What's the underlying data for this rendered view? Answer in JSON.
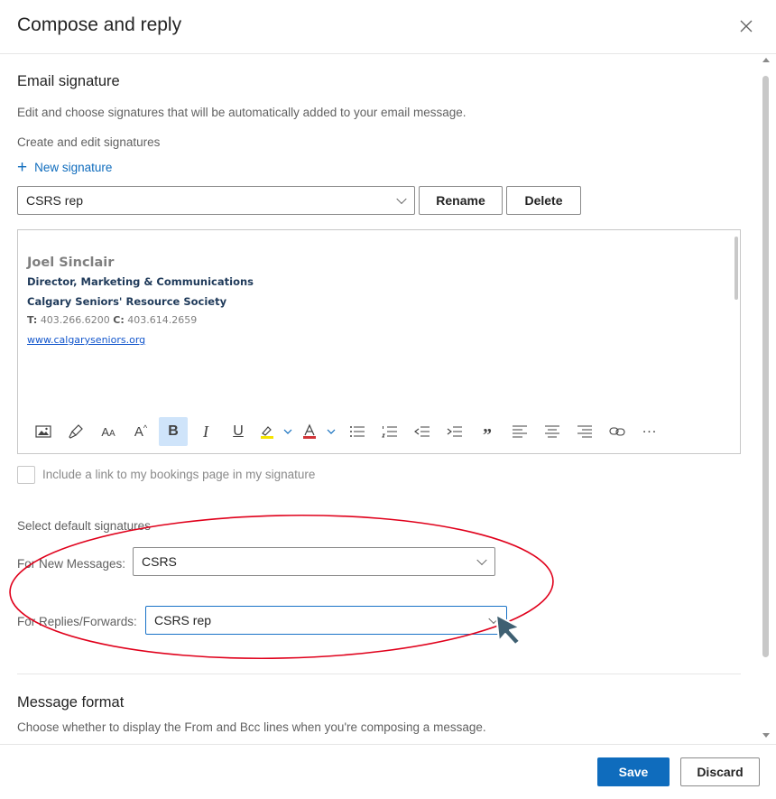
{
  "dialog": {
    "title": "Compose and reply",
    "save_label": "Save",
    "discard_label": "Discard"
  },
  "email_signature": {
    "heading": "Email signature",
    "description": "Edit and choose signatures that will be automatically added to your email message.",
    "create_edit_label": "Create and edit signatures",
    "new_signature_label": "New signature",
    "selected_signature": "CSRS rep",
    "rename_label": "Rename",
    "delete_label": "Delete",
    "signature": {
      "name": "Joel Sinclair",
      "title": "Director, Marketing & Communications",
      "organization": "Calgary Seniors' Resource Society",
      "phone_t_label": "T:",
      "phone_t": "403.266.6200",
      "phone_c_label": "C:",
      "phone_c": "403.614.2659",
      "website": "www.calgaryseniors.org"
    },
    "bookings_checkbox_label": "Include a link to my bookings page in my signature",
    "bookings_checked": false
  },
  "default_signatures": {
    "heading": "Select default signatures",
    "new_messages_label": "For New Messages:",
    "new_messages_value": "CSRS",
    "replies_label": "For Replies/Forwards:",
    "replies_value": "CSRS rep"
  },
  "message_format": {
    "heading": "Message format",
    "description": "Choose whether to display the From and Bcc lines when you're composing a message."
  },
  "colors": {
    "accent": "#0f6cbd",
    "annotation": "#e0001b"
  }
}
